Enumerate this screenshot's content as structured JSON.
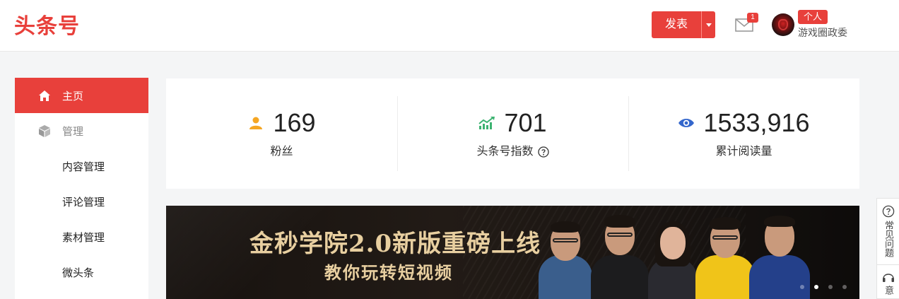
{
  "header": {
    "logo": "头条号",
    "publish_label": "发表",
    "notification_count": "1",
    "account_type": "个人",
    "account_name": "游戏圈政委"
  },
  "sidebar": {
    "items": [
      {
        "label": "主页",
        "icon": "home-icon",
        "active": true
      },
      {
        "label": "管理",
        "icon": "cube-icon",
        "group": true
      },
      {
        "label": "内容管理"
      },
      {
        "label": "评论管理"
      },
      {
        "label": "素材管理"
      },
      {
        "label": "微头条"
      }
    ]
  },
  "stats": [
    {
      "value": "169",
      "label": "粉丝",
      "icon": "user-icon",
      "color": "#f5a623"
    },
    {
      "value": "701",
      "label": "头条号指数",
      "icon": "trend-up-icon",
      "color": "#3cb371"
    },
    {
      "value": "1533,916",
      "label": "累计阅读量",
      "icon": "eye-icon",
      "color": "#3366cc"
    }
  ],
  "banner": {
    "title": "金秒学院2.0新版重磅上线",
    "subtitle": "教你玩转短视频",
    "active_slide": 2,
    "slide_count": 4
  },
  "float_help": {
    "faq_label": "常见问题",
    "feedback_label": "意"
  },
  "colors": {
    "brand": "#e8403b",
    "banner_text": "#e8cfa0"
  }
}
